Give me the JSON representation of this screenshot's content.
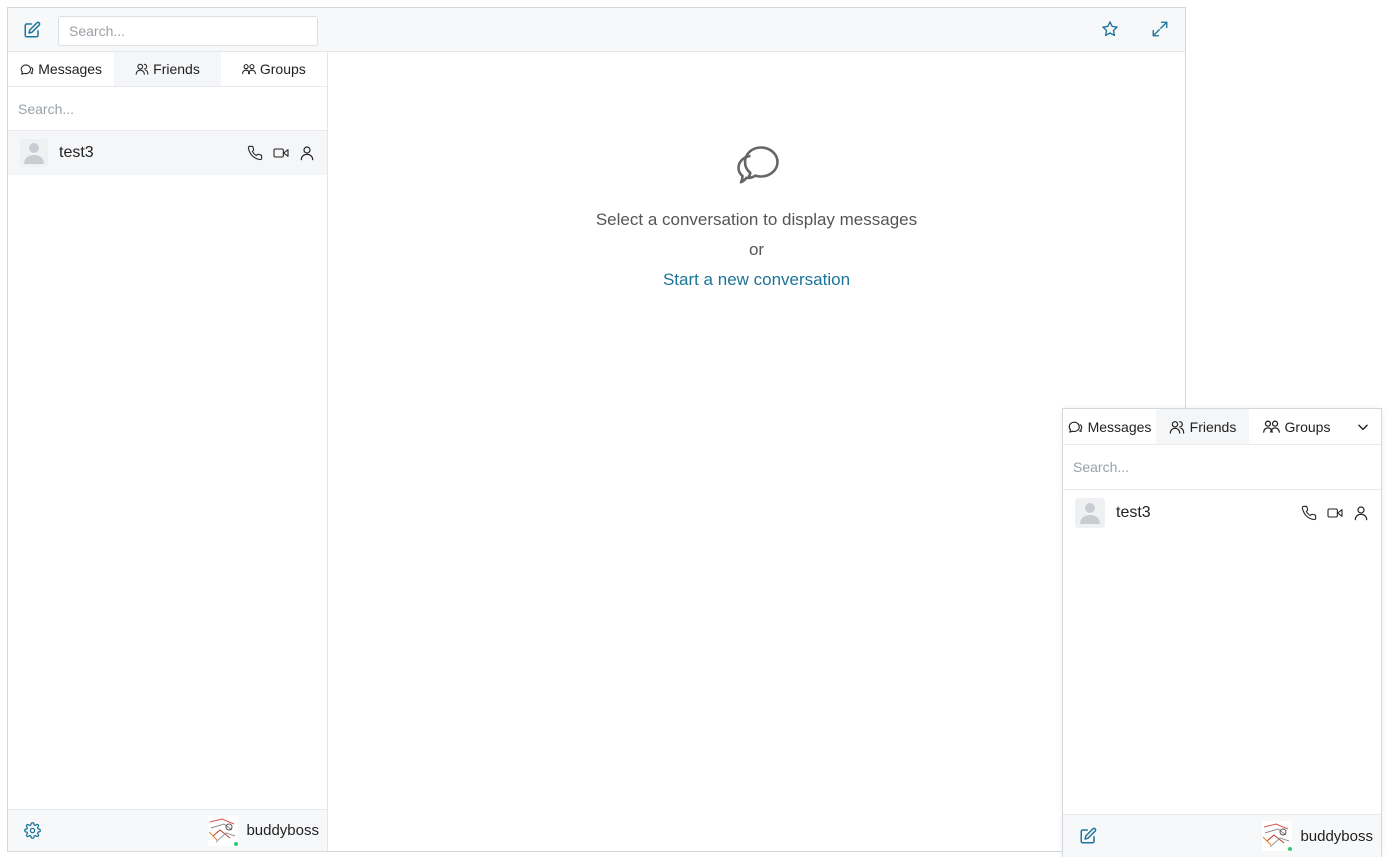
{
  "colors": {
    "accent": "#1c7499",
    "online": "#2ecc71"
  },
  "topbar": {
    "compose_icon": "edit-icon",
    "search_placeholder": "Search...",
    "favorite_icon": "star-icon",
    "expand_icon": "expand-icon"
  },
  "sidebar": {
    "tabs": [
      {
        "label": "Messages",
        "icon": "chat-bubbles-icon"
      },
      {
        "label": "Friends",
        "icon": "user-icon"
      },
      {
        "label": "Groups",
        "icon": "users-icon"
      }
    ],
    "search_placeholder": "Search...",
    "conversations": [
      {
        "name": "test3",
        "actions": [
          "phone-icon",
          "video-icon",
          "profile-icon"
        ]
      }
    ],
    "footer": {
      "settings_icon": "gear-icon",
      "username": "buddyboss"
    }
  },
  "main": {
    "empty_icon": "chat-bubbles-icon",
    "message": "Select a conversation to display messages",
    "or": "or",
    "link": "Start a new conversation"
  },
  "mini": {
    "tabs": [
      {
        "label": "Messages",
        "icon": "chat-bubbles-icon"
      },
      {
        "label": "Friends",
        "icon": "user-icon"
      },
      {
        "label": "Groups",
        "icon": "users-icon"
      }
    ],
    "collapse_icon": "chevron-down-icon",
    "search_placeholder": "Search...",
    "conversations": [
      {
        "name": "test3",
        "actions": [
          "phone-icon",
          "video-icon",
          "profile-icon"
        ]
      }
    ],
    "footer": {
      "compose_icon": "edit-icon",
      "username": "buddyboss"
    }
  }
}
